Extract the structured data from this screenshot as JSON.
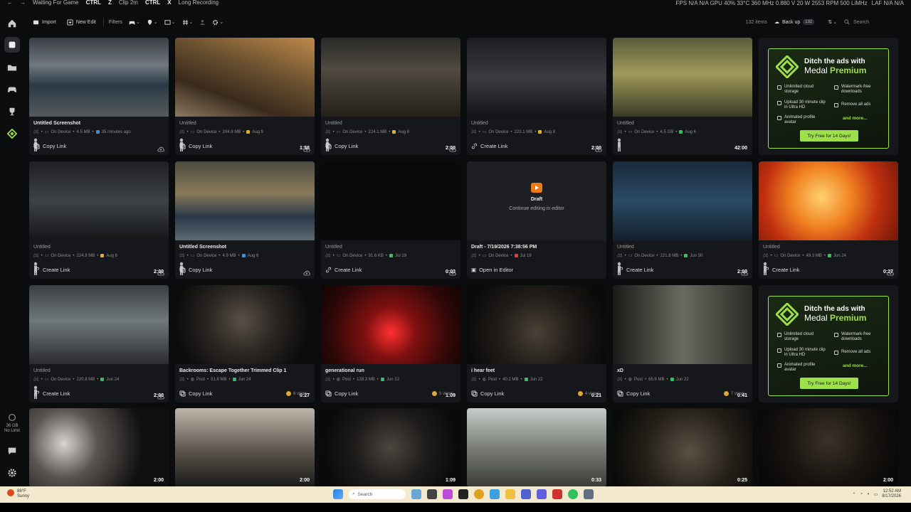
{
  "titlebar": {
    "status": "Waiting For Game",
    "key1": "CTRL",
    "key1b": "Z",
    "hotkey1": "Clip 2m",
    "key2": "CTRL",
    "key2b": "X",
    "hotkey2": "Long Recording",
    "perf": "FPS N/A N/A   GPU 40% 33°C 360 MHz 0.880 V 20 W 2553 RPM 500 LiMHz",
    "laf": "LAF N/A N/A"
  },
  "toolbar": {
    "import_label": "Import",
    "new_edit_label": "New Edit",
    "filters_label": "Filters",
    "count": "132 items",
    "backup_label": "Back up",
    "backup_badge": "132",
    "search_placeholder": "Search"
  },
  "sidebar": {
    "storage_line1": "36 GB",
    "storage_line2": "No Limit"
  },
  "colors": {
    "accent": "#9ee04a",
    "draft": "#f07a12"
  },
  "ad": {
    "heading": "Ditch the ads with",
    "brand": "Medal",
    "premium": "Premium",
    "f1": "Unlimited cloud storage",
    "f2": "Watermark-free downloads",
    "f3": "Upload 30 minute clip in Ultra HD",
    "f4": "Remove all ads",
    "f5": "Animated profile avatar",
    "more": "and more...",
    "cta": "Try Free for 14 Days!"
  },
  "draft": {
    "label": "Draft",
    "sub": "Continue editing in editor"
  },
  "cards": [
    {
      "title": "Untitled Screenshot",
      "loc": "On Device",
      "size": "4.5 MB",
      "date": "35 minutes ago",
      "dur": "",
      "action": "Copy Link",
      "views": ""
    },
    {
      "title": "Untitled",
      "loc": "On Device",
      "size": "204.9 MB",
      "date": "Aug 9",
      "dur": "1:58",
      "action": "Copy Link",
      "views": ""
    },
    {
      "title": "Untitled",
      "loc": "On Device",
      "size": "224.1 MB",
      "date": "Aug 8",
      "dur": "2:00",
      "action": "Copy Link",
      "views": ""
    },
    {
      "title": "Untitled",
      "loc": "On Device",
      "size": "223.1 MB",
      "date": "Aug 8",
      "dur": "2:00",
      "action": "Create Link",
      "views": ""
    },
    {
      "title": "Untitled",
      "loc": "On Device",
      "size": "4.5 GB",
      "date": "Aug 6",
      "dur": "42:00",
      "action": "",
      "views": ""
    },
    {
      "title": "Untitled",
      "loc": "On Device",
      "size": "224.8 MB",
      "date": "Aug 6",
      "dur": "2:00",
      "action": "Create Link",
      "views": ""
    },
    {
      "title": "Untitled Screenshot",
      "loc": "On Device",
      "size": "4.9 MB",
      "date": "Aug 6",
      "dur": "",
      "action": "Copy Link",
      "views": ""
    },
    {
      "title": "Untitled",
      "loc": "On Device",
      "size": "91.6 KB",
      "date": "Jul 19",
      "dur": "0:03",
      "action": "Create Link",
      "views": ""
    },
    {
      "title": "Draft - 7/19/2026 7:38:56 PM",
      "loc": "On Device",
      "size": "",
      "date": "Jul 19",
      "dur": "",
      "action": "Open in Editor",
      "views": ""
    },
    {
      "title": "Untitled",
      "loc": "On Device",
      "size": "221.8 MB",
      "date": "Jun 30",
      "dur": "2:00",
      "action": "Create Link",
      "views": ""
    },
    {
      "title": "Untitled",
      "loc": "On Device",
      "size": "49.3 MB",
      "date": "Jun 24",
      "dur": "0:27",
      "action": "Create Link",
      "views": ""
    },
    {
      "title": "Untitled",
      "loc": "On Device",
      "size": "220.8 MB",
      "date": "Jun 24",
      "dur": "2:00",
      "action": "Create Link",
      "views": ""
    },
    {
      "title": "Backrooms: Escape Together Trimmed Clip 1",
      "loc": "Post",
      "size": "51.8 MB",
      "date": "Jun 24",
      "dur": "0:27",
      "action": "Copy Link",
      "views": "6 views"
    },
    {
      "title": "generational run",
      "loc": "Post",
      "size": "128.3 MB",
      "date": "Jun 22",
      "dur": "1:09",
      "action": "Copy Link",
      "views": "5 views"
    },
    {
      "title": "i hear feet",
      "loc": "Post",
      "size": "40.2 MB",
      "date": "Jun 22",
      "dur": "0:21",
      "action": "Copy Link",
      "views": "4 views"
    },
    {
      "title": "xD",
      "loc": "Post",
      "size": "65.6 MB",
      "date": "Jun 22",
      "dur": "0:41",
      "action": "Copy Link",
      "views": "7 views"
    },
    {
      "dur": "2:00"
    },
    {
      "dur": "2:00"
    },
    {
      "dur": "1:09"
    },
    {
      "dur": "0:33"
    },
    {
      "dur": "0:25"
    },
    {
      "dur": "2:00"
    }
  ],
  "taskbar": {
    "temp": "88°F",
    "condition": "Sunny",
    "search": "Search",
    "time": "12:52 AM",
    "date": "8/17/2026"
  }
}
